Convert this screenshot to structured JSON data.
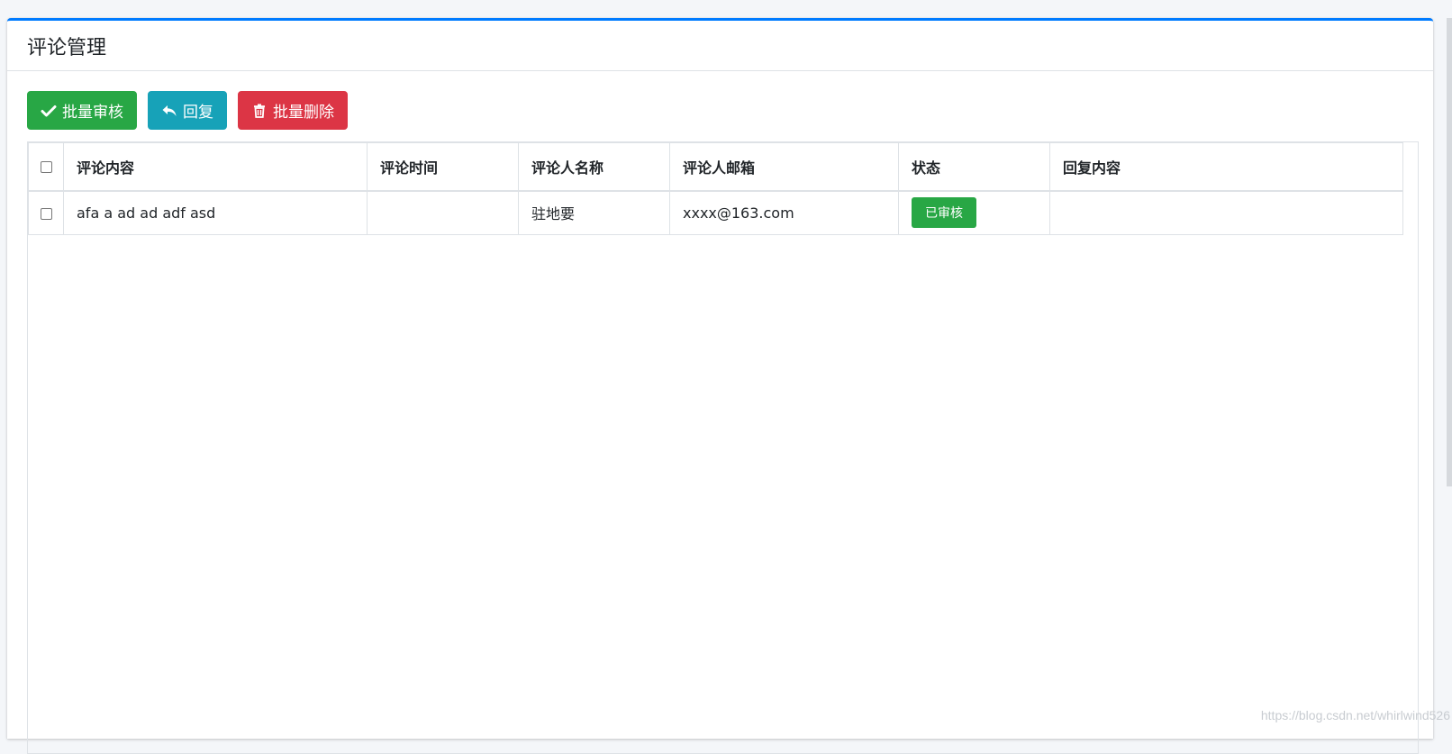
{
  "card": {
    "title": "评论管理"
  },
  "toolbar": {
    "batch_review_label": "批量审核",
    "reply_label": "回复",
    "batch_delete_label": "批量删除"
  },
  "table": {
    "columns": [
      "评论内容",
      "评论时间",
      "评论人名称",
      "评论人邮箱",
      "状态",
      "回复内容"
    ],
    "rows": [
      {
        "content": "afa a ad ad adf asd",
        "time": "",
        "name": "驻地要",
        "email": "xxxx@163.com",
        "status": "已审核",
        "reply": ""
      }
    ]
  },
  "watermark": "https://blog.csdn.net/whirlwind526",
  "colors": {
    "accent": "#007bff",
    "success": "#28a745",
    "info": "#17a2b8",
    "danger": "#dc3545"
  }
}
